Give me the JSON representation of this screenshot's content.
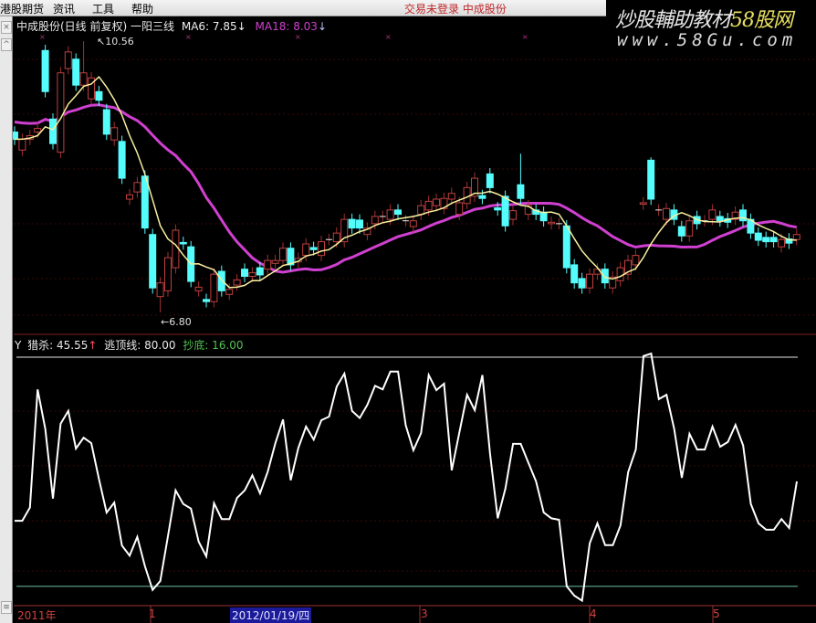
{
  "menu": {
    "items": [
      "港股期货",
      "资讯",
      "工具",
      "帮助"
    ]
  },
  "status": {
    "login": "交易未登录",
    "stock": "中成股份"
  },
  "watermark": {
    "line1": "炒股輔助教材",
    "line1_brand": "58股网",
    "line2": "www.58Gu.com"
  },
  "price_panel": {
    "title": "中成股份(日线 前复权)",
    "indicator": "一阳三线",
    "ma6_label": "MA6: 7.85",
    "ma6_arrow": "↓",
    "ma18_label": "MA18: 8.03",
    "ma18_arrow": "↓",
    "high_label": "10.56",
    "low_label": "6.80",
    "colors": {
      "up": "#ff5050",
      "down": "#54fcfc",
      "ma6": "#f8f0a0",
      "ma18": "#d040d0"
    }
  },
  "indicator_panel": {
    "y_label": "Y",
    "hunt_label": "猎杀: 45.55",
    "hunt_arrow": "↑",
    "top_label": "逃顶线: 80.00",
    "bottom_label": "抄底: 16.00"
  },
  "x_axis": {
    "labels": [
      "2011年",
      "1",
      "2012/01/19/四",
      "3",
      "4",
      "5"
    ]
  },
  "chart_data": [
    {
      "type": "candlestick",
      "title": "中成股份(日线 前复权)",
      "ylim": [
        6.8,
        10.56
      ],
      "candles": [
        [
          9.3,
          9.2
        ],
        [
          9.05,
          9.2
        ],
        [
          9.2,
          9.25
        ],
        [
          9.3,
          9.35
        ],
        [
          10.43,
          9.86
        ],
        [
          9.48,
          9.14
        ],
        [
          9.02,
          10.12
        ],
        [
          10.18,
          10.41
        ],
        [
          10.31,
          9.95
        ],
        [
          9.95,
          10.12
        ],
        [
          9.76,
          10.05
        ],
        [
          9.86,
          9.74
        ],
        [
          9.61,
          9.27
        ],
        [
          9.19,
          9.36
        ],
        [
          9.17,
          8.66
        ],
        [
          8.37,
          8.43
        ],
        [
          8.47,
          8.6
        ],
        [
          8.69,
          7.97
        ],
        [
          7.88,
          7.14
        ],
        [
          7.02,
          7.21
        ],
        [
          7.1,
          7.56
        ],
        [
          7.42,
          7.94
        ],
        [
          7.77,
          7.75
        ],
        [
          7.71,
          7.23
        ],
        [
          7.1,
          7.15
        ],
        [
          6.98,
          6.95
        ],
        [
          6.95,
          7.33
        ],
        [
          7.37,
          7.1
        ],
        [
          7.05,
          7.12
        ],
        [
          7.18,
          7.25
        ],
        [
          7.4,
          7.3
        ],
        [
          7.3,
          7.35
        ],
        [
          7.42,
          7.32
        ],
        [
          7.4,
          7.52
        ],
        [
          7.48,
          7.52
        ],
        [
          7.52,
          7.69
        ],
        [
          7.69,
          7.46
        ],
        [
          7.5,
          7.55
        ],
        [
          7.59,
          7.75
        ],
        [
          7.7,
          7.67
        ],
        [
          7.59,
          7.78
        ],
        [
          7.81,
          7.81
        ],
        [
          7.78,
          7.9
        ],
        [
          7.78,
          8.09
        ],
        [
          8.09,
          7.97
        ],
        [
          8.08,
          7.97
        ],
        [
          7.88,
          7.97
        ],
        [
          8.03,
          8.13
        ],
        [
          8.13,
          8.13
        ],
        [
          8.09,
          8.22
        ],
        [
          8.22,
          8.16
        ],
        [
          8.07,
          8.07
        ],
        [
          7.99,
          8.07
        ],
        [
          8.16,
          8.28
        ],
        [
          8.22,
          8.34
        ],
        [
          8.28,
          8.37
        ],
        [
          8.24,
          8.38
        ],
        [
          8.37,
          8.45
        ],
        [
          8.16,
          8.32
        ],
        [
          8.31,
          8.53
        ],
        [
          8.41,
          8.66
        ],
        [
          8.42,
          8.38
        ],
        [
          8.72,
          8.53
        ],
        [
          8.25,
          8.22
        ],
        [
          8.41,
          8.0
        ],
        [
          8.09,
          8.21
        ],
        [
          8.57,
          8.38
        ],
        [
          8.16,
          8.28
        ],
        [
          8.22,
          8.16
        ],
        [
          8.19,
          8.07
        ],
        [
          8.03,
          8.05
        ],
        [
          8.03,
          8.03
        ],
        [
          8.0,
          7.42
        ],
        [
          7.46,
          7.21
        ],
        [
          7.27,
          7.14
        ],
        [
          7.14,
          7.33
        ],
        [
          7.33,
          7.4
        ],
        [
          7.4,
          7.21
        ],
        [
          7.14,
          7.29
        ],
        [
          7.24,
          7.42
        ],
        [
          7.33,
          7.52
        ],
        [
          7.46,
          7.59
        ],
        [
          8.3,
          8.32
        ],
        [
          8.91,
          8.37
        ],
        [
          8.22,
          8.22
        ],
        [
          8.09,
          8.24
        ],
        [
          8.22,
          8.09
        ],
        [
          7.99,
          7.86
        ],
        [
          7.86,
          8.07
        ],
        [
          8.13,
          8.03
        ],
        [
          8.07,
          8.07
        ],
        [
          8.09,
          8.22
        ],
        [
          8.13,
          8.07
        ],
        [
          8.1,
          8.05
        ],
        [
          8.09,
          8.19
        ],
        [
          8.22,
          8.07
        ],
        [
          8.09,
          7.9
        ],
        [
          7.9,
          7.8
        ],
        [
          7.84,
          7.78
        ],
        [
          7.84,
          7.78
        ],
        [
          7.71,
          7.81
        ],
        [
          7.82,
          7.76
        ],
        [
          7.81,
          7.88
        ]
      ],
      "candle_fields": [
        "open",
        "close"
      ],
      "wick_overrides": {
        "9": {
          "high": 10.56
        },
        "19": {
          "low": 6.8
        },
        "66": {
          "high": 9.0
        },
        "83": {
          "high": 8.95
        }
      },
      "series": [
        {
          "name": "MA6"
        },
        {
          "name": "MA18"
        }
      ]
    },
    {
      "type": "line",
      "title": "一阳三线",
      "ylim": [
        10,
        82
      ],
      "reference_lines": [
        {
          "name": "逃顶线",
          "value": 80
        },
        {
          "name": "抄底",
          "value": 16
        }
      ],
      "series": [
        {
          "name": "猎杀",
          "values": [
            34.3,
            34.3,
            38,
            71,
            60,
            40.5,
            61.4,
            65,
            54.5,
            57.5,
            56,
            46,
            36.6,
            39.4,
            27.4,
            24.6,
            29.8,
            21.6,
            15,
            17.5,
            30,
            42.8,
            39,
            37.7,
            28.5,
            24.4,
            39.2,
            34.8,
            34.8,
            40.7,
            42.8,
            47,
            42,
            48,
            56,
            62.6,
            45.6,
            54.7,
            60.6,
            57,
            62.4,
            63.4,
            71.8,
            75.4,
            65,
            63,
            66.7,
            72,
            71,
            76,
            76,
            61,
            54,
            58.8,
            75,
            70.8,
            72.6,
            48.4,
            59,
            69.5,
            65.2,
            75,
            53,
            35,
            43.3,
            55.8,
            55.8,
            50.5,
            45.3,
            36.6,
            35,
            34.6,
            16,
            13.4,
            12,
            28,
            33.6,
            27.5,
            27.5,
            33,
            47.9,
            54.2,
            80.3,
            81,
            68.3,
            69.5,
            60,
            46.3,
            58.6,
            54.2,
            54.2,
            60.6,
            55,
            56.3,
            61.1,
            55.3,
            39,
            33.6,
            31.8,
            31.8,
            34.8,
            32.3,
            45.3
          ]
        }
      ]
    }
  ]
}
